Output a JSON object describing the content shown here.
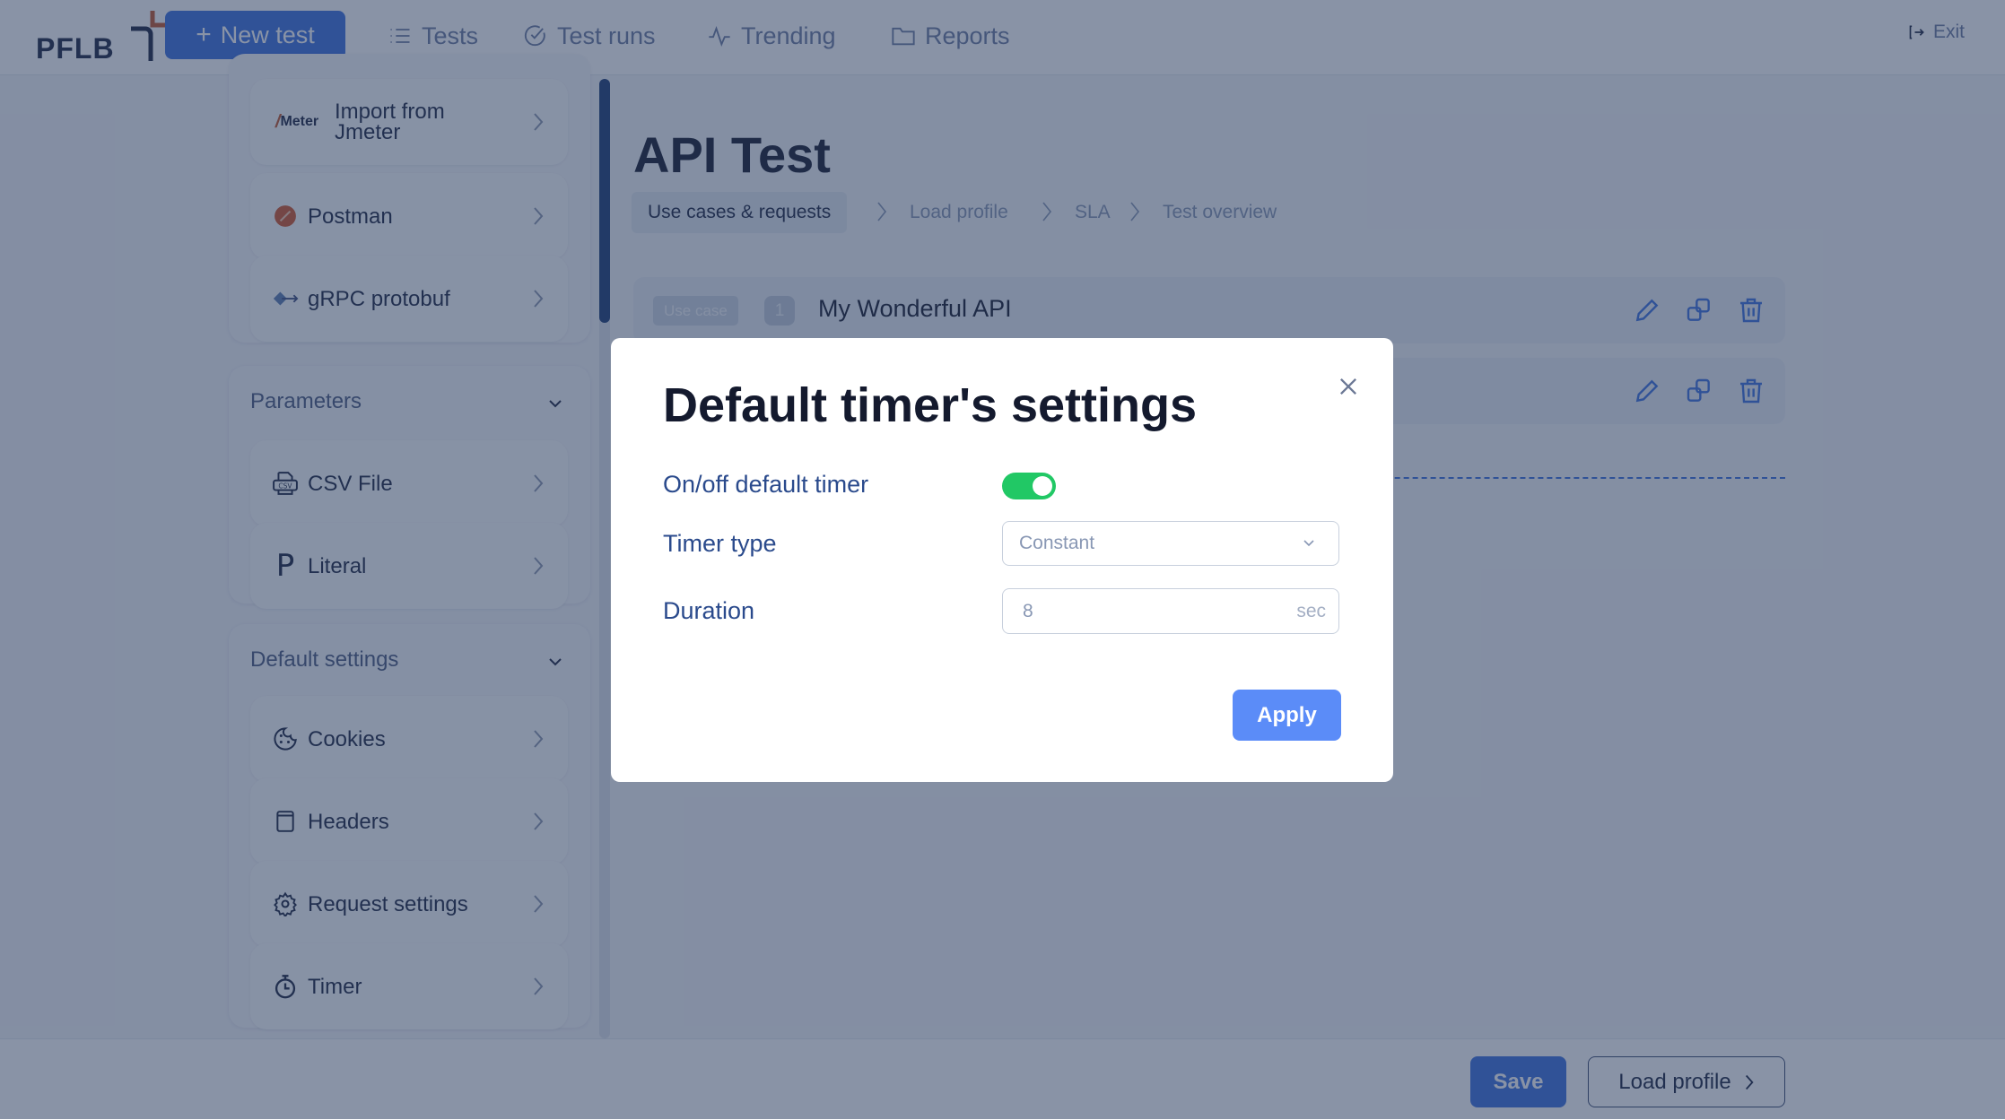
{
  "header": {
    "logo_text": "PFLB",
    "new_test_label": "New test",
    "nav": [
      {
        "label": "Tests",
        "icon": "list-icon"
      },
      {
        "label": "Test runs",
        "icon": "check-circle-icon"
      },
      {
        "label": "Trending",
        "icon": "pulse-icon"
      },
      {
        "label": "Reports",
        "icon": "folder-icon"
      }
    ],
    "exit_label": "Exit"
  },
  "sidebar": {
    "import_items": [
      {
        "label_line1": "Import from",
        "label_line2": "Jmeter",
        "icon": "jmeter-icon",
        "icon_text": "Meter"
      },
      {
        "label": "Postman",
        "icon": "postman-icon"
      },
      {
        "label": "gRPC protobuf",
        "icon": "grpc-icon"
      }
    ],
    "parameters": {
      "title": "Parameters",
      "items": [
        {
          "label": "CSV File",
          "icon": "csv-file-icon",
          "icon_text": "CSV"
        },
        {
          "label": "Literal",
          "icon": "literal-icon",
          "icon_text": "P"
        }
      ]
    },
    "default_settings": {
      "title": "Default settings",
      "items": [
        {
          "label": "Cookies",
          "icon": "cookie-icon"
        },
        {
          "label": "Headers",
          "icon": "headers-icon"
        },
        {
          "label": "Request settings",
          "icon": "gear-icon"
        },
        {
          "label": "Timer",
          "icon": "stopwatch-icon"
        }
      ]
    }
  },
  "main": {
    "title": "API Test",
    "breadcrumbs": [
      "Use cases & requests",
      "Load profile",
      "SLA",
      "Test overview"
    ],
    "active_breadcrumb": 0,
    "use_cases": [
      {
        "badge": "Use case",
        "number": "1",
        "name": "My Wonderful API"
      },
      {
        "badge": "",
        "number": "",
        "name": ""
      }
    ]
  },
  "footer": {
    "save_label": "Save",
    "load_profile_label": "Load profile"
  },
  "modal": {
    "title": "Default timer's settings",
    "toggle_label": "On/off default timer",
    "toggle_on": true,
    "timer_type_label": "Timer type",
    "timer_type_value": "Constant",
    "duration_label": "Duration",
    "duration_value": "8",
    "duration_unit": "sec",
    "apply_label": "Apply"
  },
  "colors": {
    "accent": "#3a6fde",
    "apply": "#5b8cf8",
    "toggle_on": "#21c865",
    "brand_orange": "#c0562a",
    "text_dark": "#141a2e"
  }
}
